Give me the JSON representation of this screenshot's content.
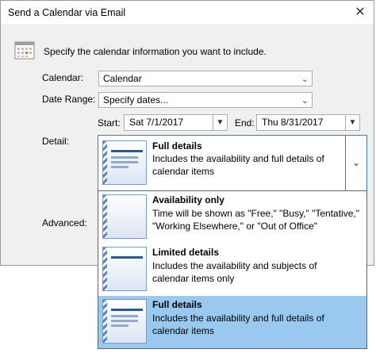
{
  "window": {
    "title": "Send a Calendar via Email",
    "close_glyph": "✕"
  },
  "intro_text": "Specify the calendar information you want to include.",
  "calendar": {
    "label": "Calendar:",
    "value": "Calendar"
  },
  "date_range": {
    "label": "Date Range:",
    "value": "Specify dates..."
  },
  "start": {
    "label": "Start:",
    "value": "Sat 7/1/2017"
  },
  "end": {
    "label": "End:",
    "value": "Thu 8/31/2017"
  },
  "detail": {
    "label": "Detail:",
    "current": {
      "title": "Full details",
      "desc": "Includes the availability and full details of calendar items"
    }
  },
  "advanced": {
    "label": "Advanced:"
  },
  "options": [
    {
      "title": "Availability only",
      "desc": "Time will be shown as \"Free,\" \"Busy,\" \"Tentative,\" \"Working Elsewhere,\" or \"Out of Office\""
    },
    {
      "title": "Limited details",
      "desc": "Includes the availability and subjects of calendar items only"
    },
    {
      "title": "Full details",
      "desc": "Includes the availability and full details of calendar items"
    }
  ],
  "icons": {
    "calendar": "calendar-icon",
    "dropdown": "chevron-down-icon",
    "close": "close-icon"
  },
  "colors": {
    "selection": "#99c9ef",
    "focus_border": "#3c7fb1",
    "thumb_accent": "#2b579a"
  }
}
